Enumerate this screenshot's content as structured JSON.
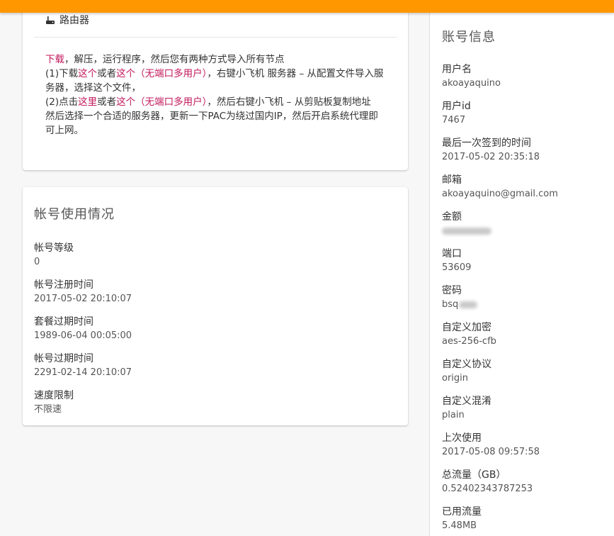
{
  "download_card": {
    "router_label": "路由器",
    "line1": {
      "download_link": "下载",
      "rest": "，解压，运行程序，然后您有两种方式导入所有节点"
    },
    "line2": {
      "prefix": "(1)下载",
      "link_this": "这个",
      "or": "或者",
      "link_this2": "这个（无端口多用户）",
      "rest": "，右键小飞机 服务器 – 从配置文件导入服务器，选择这个文件，"
    },
    "line3": {
      "prefix": "(2)点击",
      "link_here": "这里",
      "or": "或者",
      "link_this": "这个（无端口多用户）",
      "rest": "，然后右键小飞机 – 从剪贴板复制地址"
    },
    "line4": "然后选择一个合适的服务器，更新一下PAC为绕过国内IP，然后开启系统代理即可上网。"
  },
  "usage_card": {
    "title": "帐号使用情况",
    "fields": [
      {
        "label": "帐号等级",
        "value": "0"
      },
      {
        "label": "帐号注册时间",
        "value": "2017-05-02 20:10:07"
      },
      {
        "label": "套餐过期时间",
        "value": "1989-06-04 00:05:00"
      },
      {
        "label": "帐号过期时间",
        "value": "2291-02-14 20:10:07"
      },
      {
        "label": "速度限制",
        "value": "不限速"
      }
    ]
  },
  "account_info": {
    "title": "账号信息",
    "fields": [
      {
        "label": "用户名",
        "value": "akoayaquino"
      },
      {
        "label": "用户id",
        "value": "7467"
      },
      {
        "label": "最后一次签到的时间",
        "value": "2017-05-02 20:35:18"
      },
      {
        "label": "邮箱",
        "value": "akoayaquino@gmail.com"
      },
      {
        "label": "金额",
        "value": ""
      },
      {
        "label": "端口",
        "value": "53609"
      },
      {
        "label": "密码",
        "value": "bsq"
      },
      {
        "label": "自定义加密",
        "value": "aes-256-cfb"
      },
      {
        "label": "自定义协议",
        "value": "origin"
      },
      {
        "label": "自定义混淆",
        "value": "plain"
      },
      {
        "label": "上次使用",
        "value": "2017-05-08 09:57:58"
      },
      {
        "label": "总流量（GB）",
        "value": "0.52402343787253"
      },
      {
        "label": "已用流量",
        "value": "5.48MB"
      }
    ]
  },
  "colors": {
    "topbar": "#ff9800",
    "link": "#c2185b"
  }
}
